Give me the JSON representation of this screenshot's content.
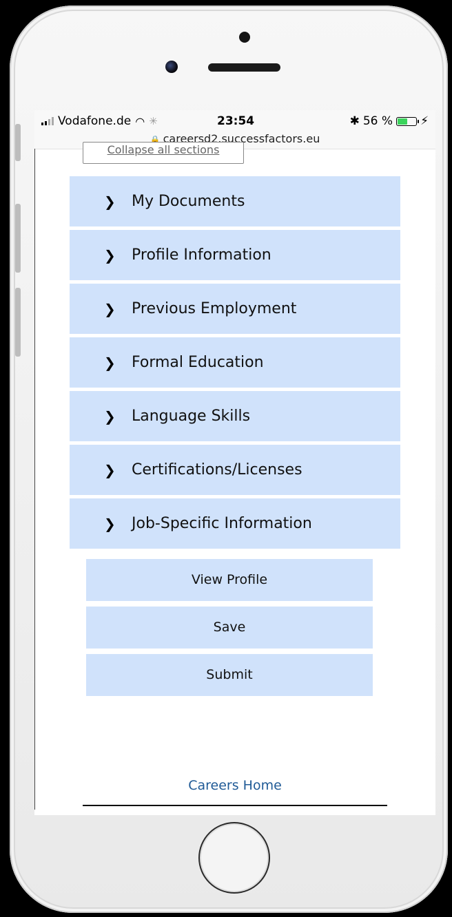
{
  "status_bar": {
    "carrier": "Vodafone.de",
    "time": "23:54",
    "bluetooth": "✱",
    "battery": "56 %",
    "battery_level": 0.56,
    "charging": "⚡"
  },
  "browser": {
    "url": "careersd2.successfactors.eu"
  },
  "collapse_all": "Collapse all sections",
  "sections": [
    {
      "label": "My Documents"
    },
    {
      "label": "Profile Information"
    },
    {
      "label": "Previous Employment"
    },
    {
      "label": "Formal Education"
    },
    {
      "label": "Language Skills"
    },
    {
      "label": "Certifications/Licenses"
    },
    {
      "label": "Job-Specific Information"
    }
  ],
  "actions": {
    "view_profile": "View Profile",
    "save": "Save",
    "submit": "Submit"
  },
  "footer": {
    "careers_home": "Careers Home"
  },
  "colors": {
    "section_bg": "#d0e2fb",
    "link": "#1f5a96"
  }
}
